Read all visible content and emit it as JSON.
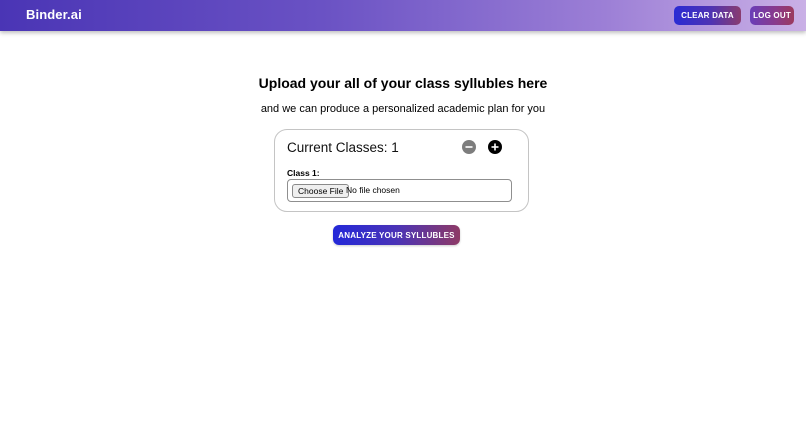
{
  "navbar": {
    "brand": "Binder.ai",
    "clear_label": "CLEAR DATA",
    "logout_label": "LOG OUT"
  },
  "main": {
    "heading": "Upload your all of your class syllubles here",
    "subheading": "and we can produce a personalized academic plan for you"
  },
  "classes_card": {
    "title": "Current Classes: 1",
    "remove_icon": "minus-circle-icon",
    "add_icon": "plus-circle-icon",
    "classes": [
      {
        "label": "Class 1:",
        "choose_file_label": "Choose File",
        "file_status": "No file chosen"
      }
    ]
  },
  "analyze_label": "ANALYZE YOUR SYLLUBLES",
  "colors": {
    "nav_gradient_start": "#4a35b5",
    "nav_gradient_end": "#cab0e6",
    "button_gradient_start": "#2328d8",
    "button_gradient_end": "#8e3a66"
  }
}
